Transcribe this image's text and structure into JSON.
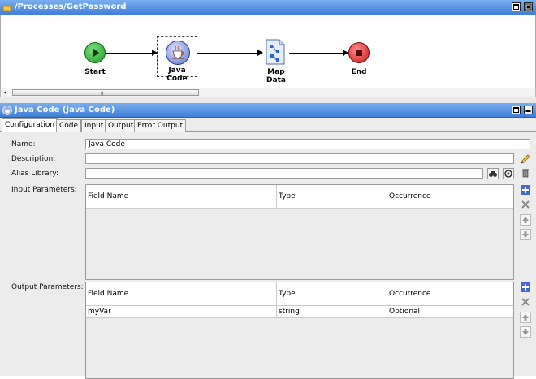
{
  "process_panel": {
    "title": "/Processes/GetPassword",
    "nodes": [
      {
        "label": "Start"
      },
      {
        "label": "Java Code"
      },
      {
        "label": "Map Data"
      },
      {
        "label": "End"
      }
    ],
    "scroll_grip": "III"
  },
  "activity_panel": {
    "title": "Java Code (Java Code)",
    "tabs": [
      "Configuration",
      "Code",
      "Input",
      "Output",
      "Error Output"
    ]
  },
  "form": {
    "name_label": "Name:",
    "name_value": "Java Code",
    "description_label": "Description:",
    "description_value": "",
    "alias_label": "Alias Library:",
    "alias_value": "",
    "input_params_label": "Input Parameters:",
    "output_params_label": "Output Parameters:",
    "columns": [
      "Field Name",
      "Type",
      "Occurrence"
    ],
    "output_rows": [
      {
        "field": "myVar",
        "type": "string",
        "occurrence": "Optional"
      }
    ]
  },
  "colors": {
    "titlebar": "#4a88dc",
    "start": "#22aa33",
    "end": "#dd2222"
  }
}
